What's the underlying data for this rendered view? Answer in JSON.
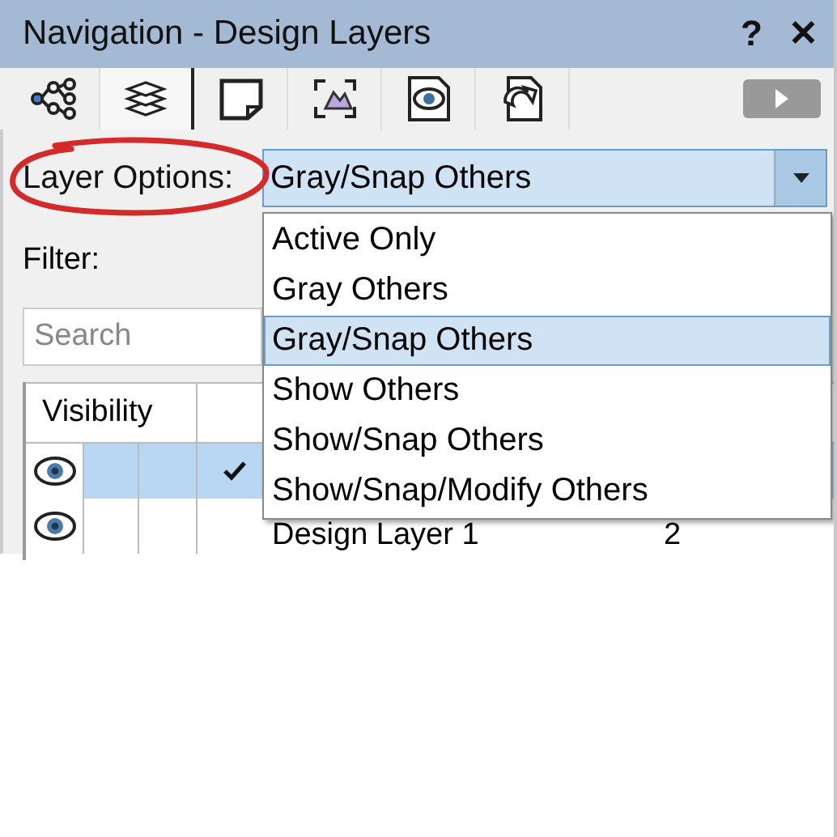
{
  "window": {
    "title": "Navigation - Design Layers",
    "help": "?",
    "close": "✕"
  },
  "tabs": [
    {
      "kind": "graph",
      "selected": false
    },
    {
      "kind": "layers",
      "selected": true
    },
    {
      "kind": "sheet",
      "selected": false
    },
    {
      "kind": "viewport",
      "selected": false
    },
    {
      "kind": "view",
      "selected": false
    },
    {
      "kind": "reference",
      "selected": false
    }
  ],
  "layer_options": {
    "label": "Layer Options:",
    "value": "Gray/Snap Others",
    "menu": [
      {
        "label": "Active Only",
        "selected": false
      },
      {
        "label": "Gray Others",
        "selected": false
      },
      {
        "label": "Gray/Snap Others",
        "selected": true
      },
      {
        "label": "Show Others",
        "selected": false
      },
      {
        "label": "Show/Snap Others",
        "selected": false
      },
      {
        "label": "Show/Snap/Modify Others",
        "selected": false
      }
    ]
  },
  "filter": {
    "label": "Filter:"
  },
  "search": {
    "placeholder": "Search"
  },
  "table": {
    "columns": [
      "Visibility"
    ],
    "rows": [
      {
        "selected": true,
        "active": true
      },
      {
        "selected": false,
        "active": false,
        "name": "Design Layer 1",
        "column_3": "2"
      }
    ]
  }
}
